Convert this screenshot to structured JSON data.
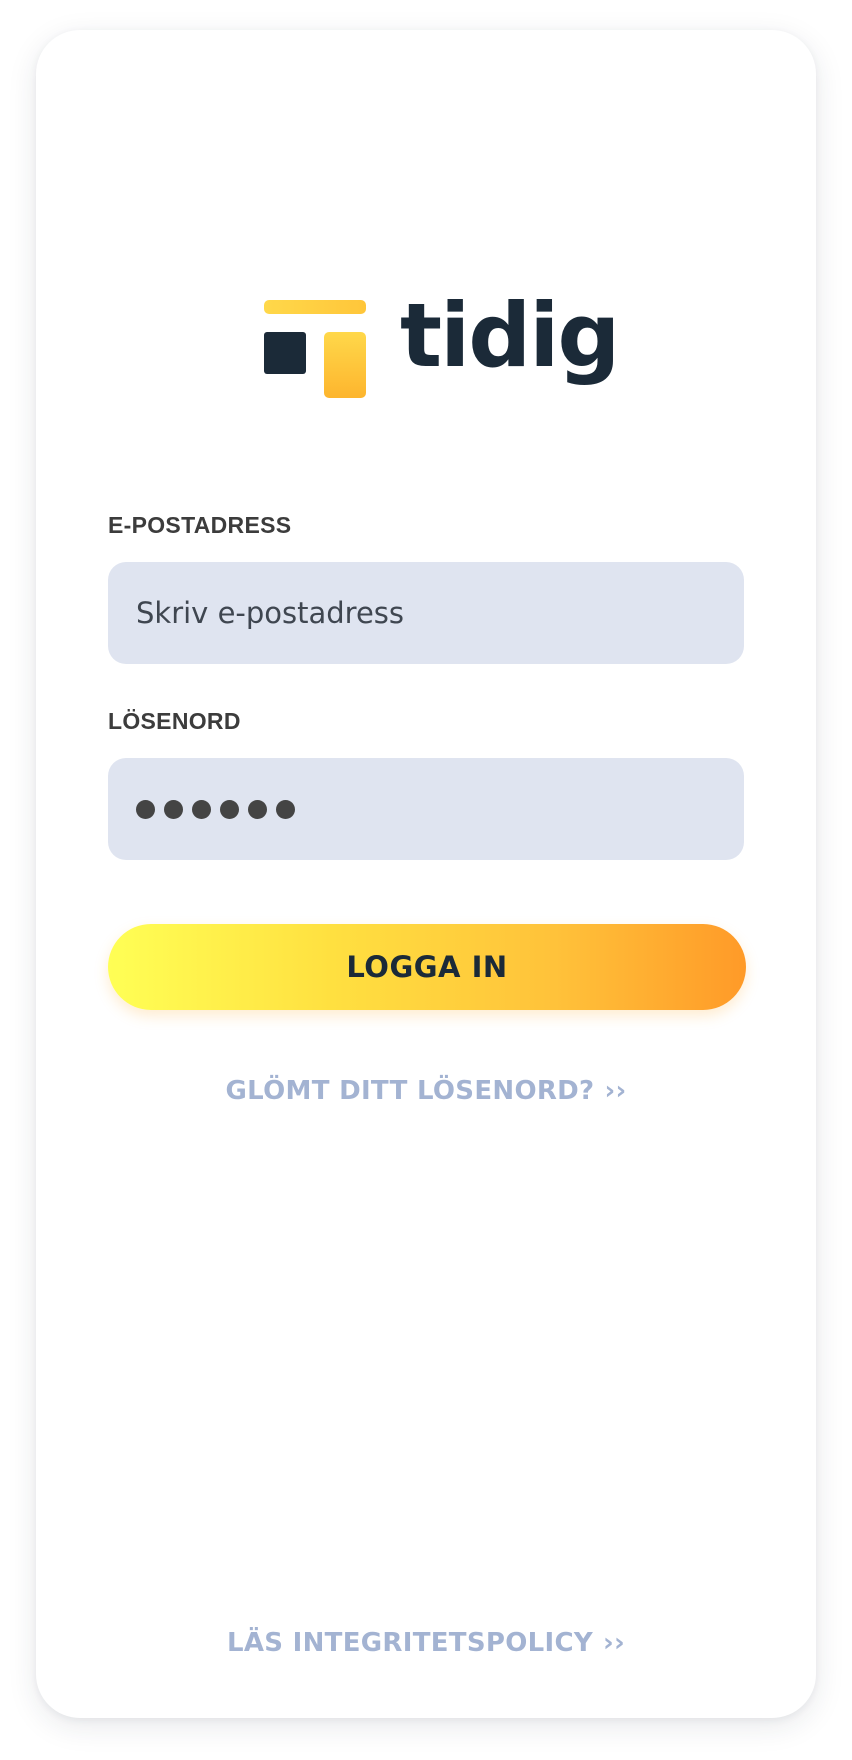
{
  "brand": {
    "name": "tidig",
    "colors": {
      "dark": "#1b2a38",
      "yellow": "#ffc63a",
      "orange": "#ff9a28"
    }
  },
  "form": {
    "email": {
      "label": "E-POSTADRESS",
      "placeholder": "Skriv e-postadress",
      "value": ""
    },
    "password": {
      "label": "LÖSENORD",
      "masked_value": "●●●●●●",
      "length": 6
    },
    "submit_label": "LOGGA IN"
  },
  "links": {
    "forgot_password": "GLÖMT DITT LÖSENORD?",
    "privacy_policy": "LÄS INTEGRITETSPOLICY",
    "chevron": "››"
  },
  "icons": {
    "logo": "tidig-logo-mark",
    "link_arrow": "double-chevron-right-icon"
  }
}
